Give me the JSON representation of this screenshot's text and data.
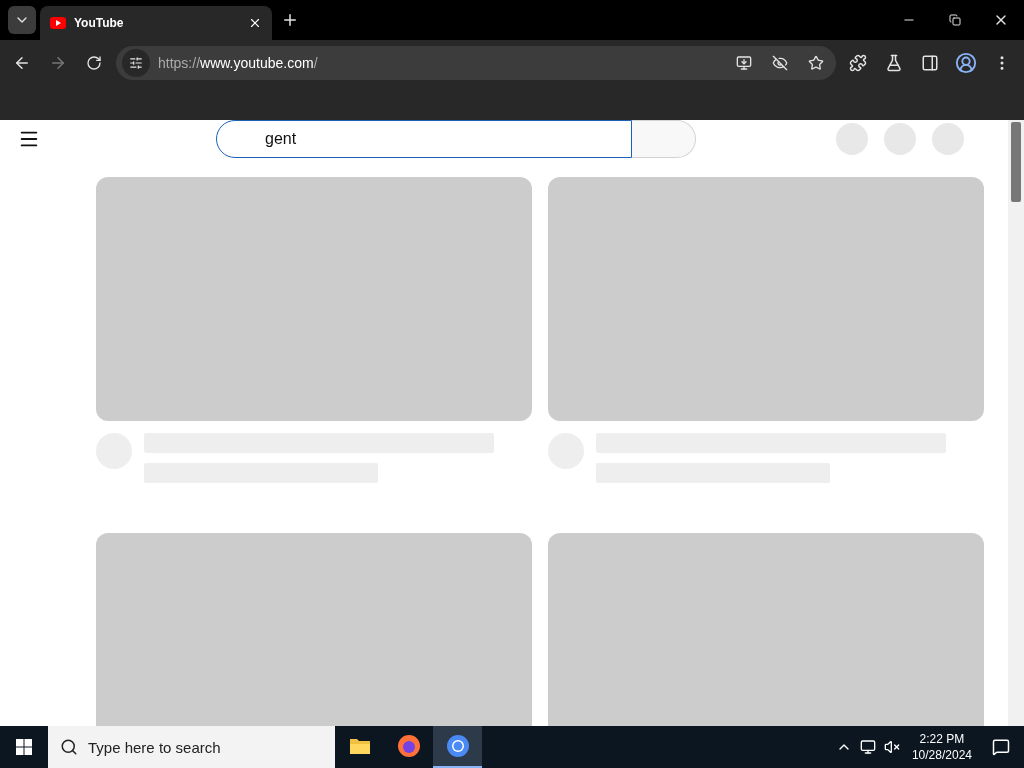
{
  "tabs": [
    {
      "title": "YouTube",
      "selected": true
    }
  ],
  "address_bar": {
    "scheme": "https://",
    "host": "www.youtube.com",
    "path": "/"
  },
  "search": {
    "value": "gent"
  },
  "taskbar": {
    "search_placeholder": "Type here to search",
    "apps": [
      {
        "kind": "files",
        "selected": false
      },
      {
        "kind": "firefox",
        "selected": false
      },
      {
        "kind": "chrome",
        "selected": true
      }
    ],
    "time": "2:22 PM",
    "date": "10/28/2024"
  }
}
